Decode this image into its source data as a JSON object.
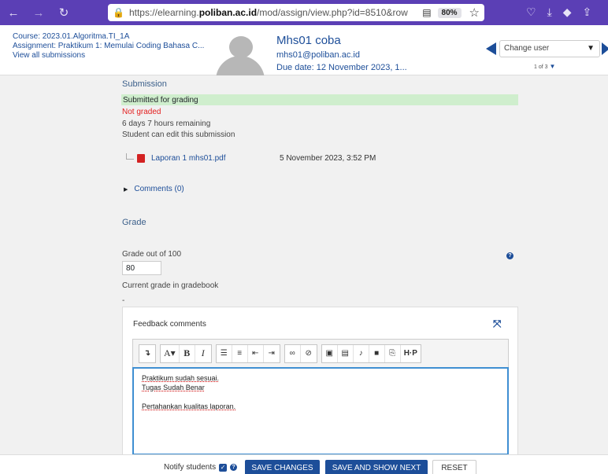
{
  "browser": {
    "back_icon": "←",
    "forward_icon": "→",
    "reload_icon": "↻",
    "url_prefix": "https://elearning.",
    "url_host": "poliban.ac.id",
    "url_path": "/mod/assign/view.php?id=8510&row",
    "zoom": "80%"
  },
  "header": {
    "course": "Course: 2023.01.Algoritma.TI_1A",
    "assignment": "Assignment: Praktikum 1: Memulai Coding Bahasa C...",
    "view_all": "View all submissions",
    "user_name": "Mhs01 coba",
    "user_email": "mhs01@poliban.ac.id",
    "due_date": "Due date: 12 November 2023, 1...",
    "change_user": "Change user",
    "user_count": "1 of 3"
  },
  "submission": {
    "heading": "Submission",
    "status": "Submitted for grading",
    "grading_status": "Not graded",
    "time_remaining": "6 days 7 hours remaining",
    "edit_note": "Student can edit this submission",
    "file_name": "Laporan 1 mhs01.pdf",
    "file_date": "5 November 2023, 3:52 PM",
    "comments": "Comments (0)"
  },
  "grade": {
    "heading": "Grade",
    "label": "Grade out of 100",
    "value": "80",
    "gradebook_label": "Current grade in gradebook",
    "gradebook_value": "-"
  },
  "feedback": {
    "title": "Feedback comments",
    "lines": [
      "Praktikum sudah sesuai.",
      "Tugas Sudah Benar",
      "Pertahankan kualitas laporan."
    ]
  },
  "footer": {
    "notify_label": "Notify students",
    "save_changes": "SAVE CHANGES",
    "save_and_next": "SAVE AND SHOW NEXT",
    "reset": "RESET"
  },
  "colors": {
    "browser_bar": "#5b3fb5",
    "link_blue": "#1d4e99",
    "submitted_bg": "#cfeecd",
    "not_graded": "#e31e1e",
    "editor_focus": "#3f8fd2"
  }
}
